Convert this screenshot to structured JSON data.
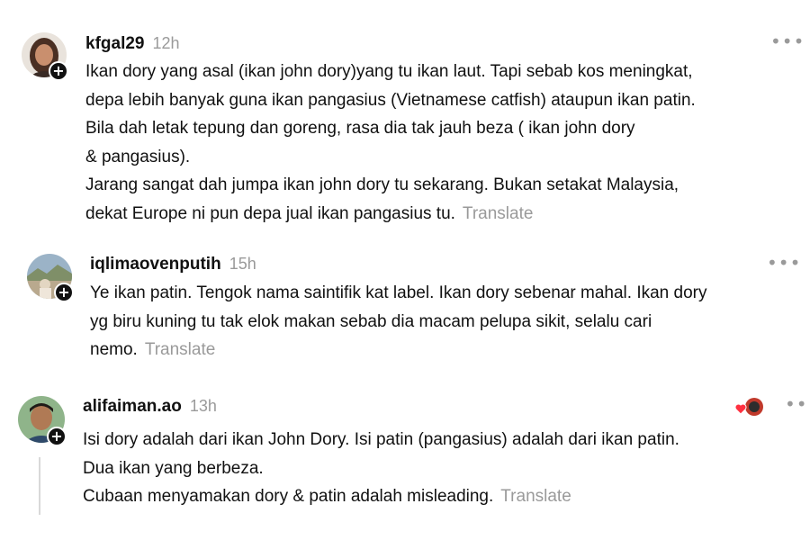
{
  "comments": [
    {
      "username": "kfgal29",
      "time": "12h",
      "text": "Ikan dory yang asal (ikan john dory)yang tu ikan laut. Tapi sebab kos meningkat,\ndepa lebih banyak guna ikan pangasius (Vietnamese catfish) ataupun ikan patin.\nBila dah letak tepung dan goreng, rasa dia tak jauh beza ( ikan john dory\n& pangasius).\nJarang sangat dah jumpa ikan john dory tu sekarang. Bukan setakat Malaysia,\ndekat Europe ni pun depa jual ikan pangasius tu.",
      "translate": "Translate",
      "more_icon": "more-horizontal-icon"
    },
    {
      "username": "iqlimaovenputih",
      "time": "15h",
      "text": "Ye ikan patin. Tengok nama saintifik kat label. Ikan dory sebenar mahal. Ikan dory\nyg biru kuning tu tak elok makan sebab dia macam pelupa sikit, selalu cari\nnemo.",
      "translate": "Translate",
      "more_icon": "more-horizontal-icon"
    },
    {
      "username": "alifaiman.ao",
      "time": "13h",
      "text": "Isi dory adalah dari ikan John Dory. Isi patin (pangasius) adalah dari ikan patin.\nDua ikan yang berbeza.\nCubaan menyamakan dory & patin adalah misleading.",
      "translate": "Translate",
      "more_icon": "more-horizontal-icon",
      "liked_by_author": true
    }
  ],
  "colors": {
    "text": "#111111",
    "muted": "#9a9a9a",
    "heart": "#ff3040",
    "thread_line": "#d9d9d9"
  }
}
